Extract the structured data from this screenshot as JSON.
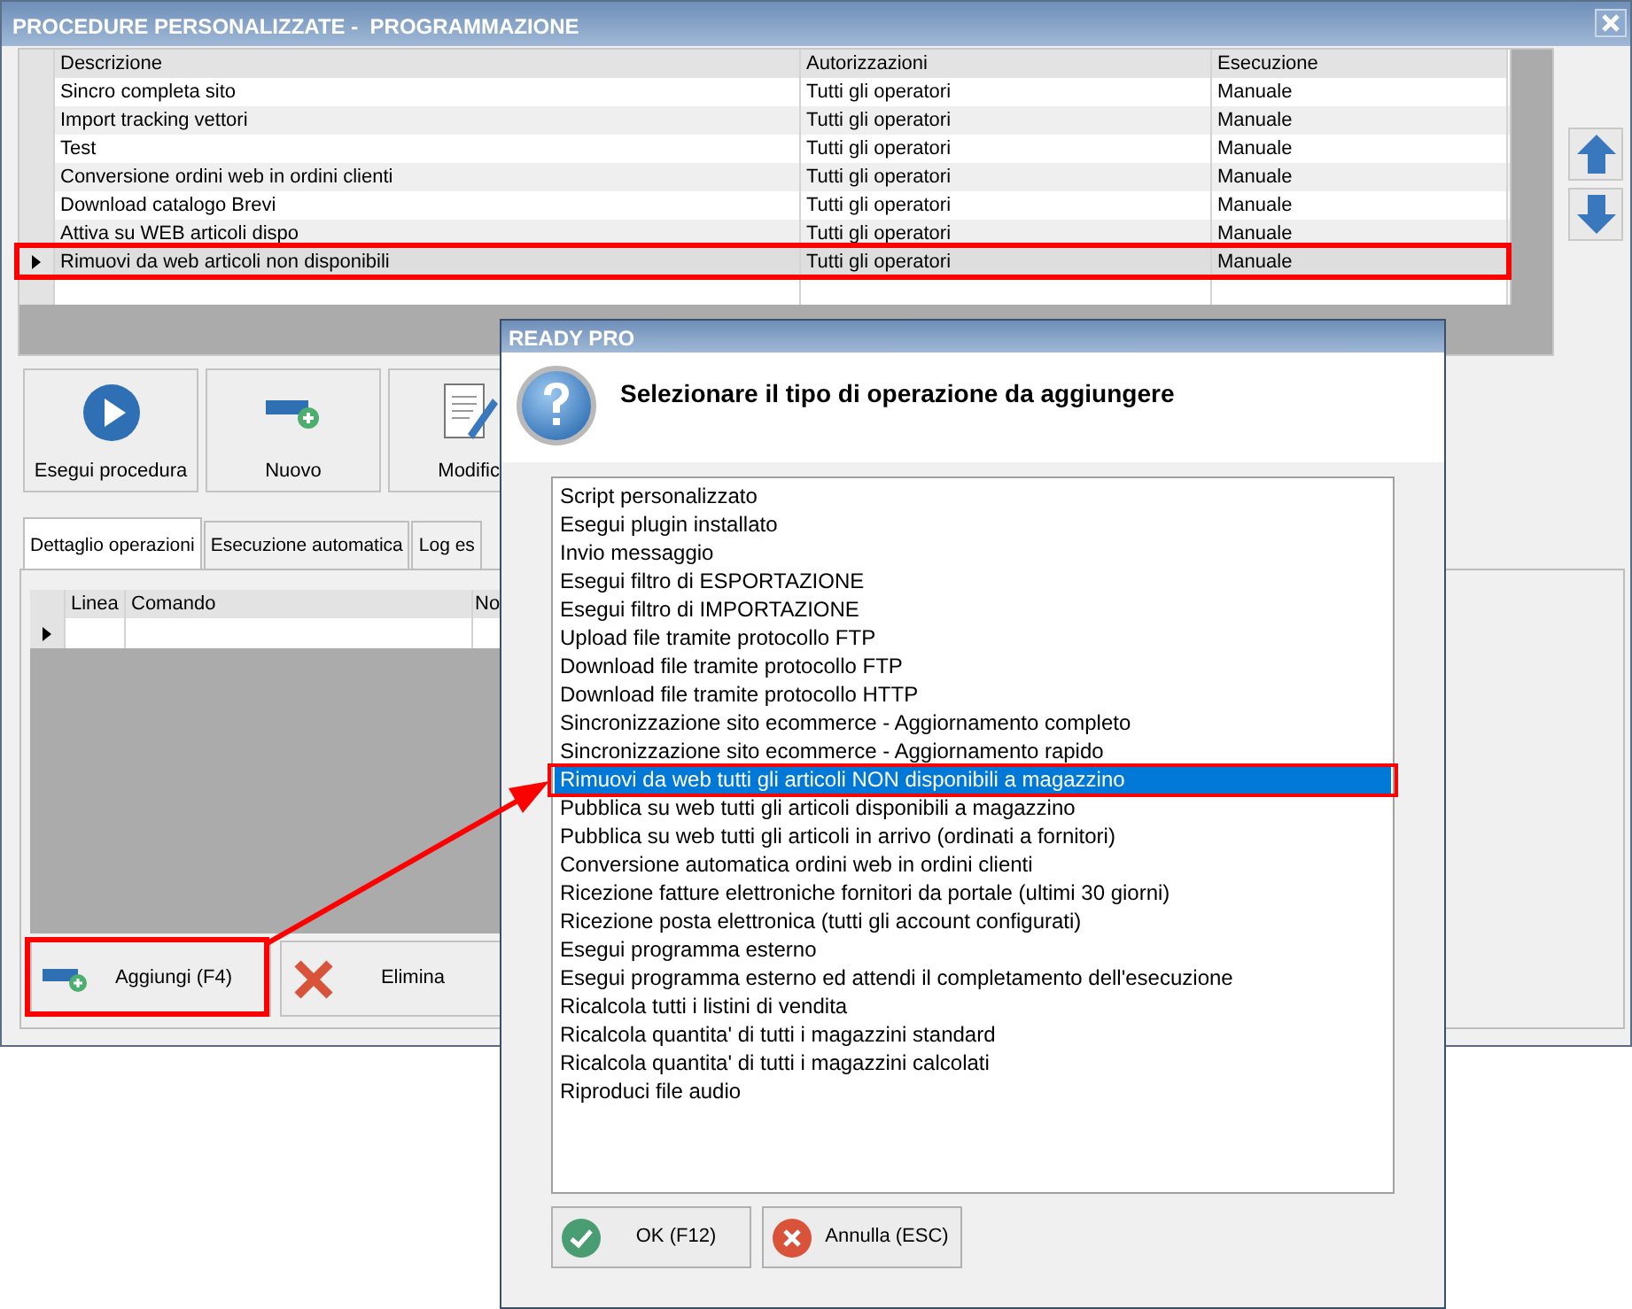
{
  "window": {
    "title": "PROCEDURE PERSONALIZZATE -  PROGRAMMAZIONE"
  },
  "procedures": {
    "columns": [
      "Descrizione",
      "Autorizzazioni",
      "Esecuzione"
    ],
    "rows": [
      {
        "cells": [
          "Sincro completa sito",
          "Tutti gli operatori",
          "Manuale"
        ],
        "selected": false
      },
      {
        "cells": [
          "Import tracking vettori",
          "Tutti gli operatori",
          "Manuale"
        ],
        "selected": false
      },
      {
        "cells": [
          "Test",
          "Tutti gli operatori",
          "Manuale"
        ],
        "selected": false
      },
      {
        "cells": [
          "Conversione ordini web in ordini clienti",
          "Tutti gli operatori",
          "Manuale"
        ],
        "selected": false
      },
      {
        "cells": [
          "Download catalogo Brevi",
          "Tutti gli operatori",
          "Manuale"
        ],
        "selected": false
      },
      {
        "cells": [
          "Attiva su WEB articoli dispo",
          "Tutti gli operatori",
          "Manuale"
        ],
        "selected": false
      },
      {
        "cells": [
          "Rimuovi da web articoli non disponibili",
          "Tutti gli operatori",
          "Manuale"
        ],
        "selected": true
      }
    ]
  },
  "toolbar": [
    {
      "label": "Esegui procedura",
      "kind": "run"
    },
    {
      "label": "Nuovo",
      "kind": "new"
    },
    {
      "label": "Modific",
      "kind": "edit"
    }
  ],
  "tabs": [
    {
      "label": "Dettaglio operazioni",
      "selected": true
    },
    {
      "label": "Esecuzione automatica",
      "selected": false
    },
    {
      "label": "Log es",
      "selected": false
    }
  ],
  "operations": {
    "columns": [
      "Linea",
      "Comando",
      "No"
    ],
    "rows": [
      {
        "current": true
      }
    ]
  },
  "operation_buttons": [
    {
      "label": "Aggiungi (F4)",
      "kind": "add"
    },
    {
      "label": "Elimina",
      "kind": "delete"
    }
  ],
  "dialog": {
    "title": "READY PRO",
    "heading": "Selezionare il tipo di operazione da aggiungere",
    "options": [
      {
        "label": "Script personalizzato",
        "selected": false
      },
      {
        "label": "Esegui plugin installato",
        "selected": false
      },
      {
        "label": "Invio messaggio",
        "selected": false
      },
      {
        "label": "Esegui filtro di ESPORTAZIONE",
        "selected": false
      },
      {
        "label": "Esegui filtro di IMPORTAZIONE",
        "selected": false
      },
      {
        "label": "Upload file tramite protocollo FTP",
        "selected": false
      },
      {
        "label": "Download file tramite protocollo FTP",
        "selected": false
      },
      {
        "label": "Download file tramite protocollo HTTP",
        "selected": false
      },
      {
        "label": "Sincronizzazione sito ecommerce - Aggiornamento completo",
        "selected": false
      },
      {
        "label": "Sincronizzazione sito ecommerce - Aggiornamento rapido",
        "selected": false
      },
      {
        "label": "Rimuovi da web tutti gli articoli NON disponibili a magazzino",
        "selected": true
      },
      {
        "label": "Pubblica su web tutti gli articoli disponibili a magazzino",
        "selected": false
      },
      {
        "label": "Pubblica su web tutti gli articoli in arrivo (ordinati a fornitori)",
        "selected": false
      },
      {
        "label": "Conversione automatica ordini web in ordini clienti",
        "selected": false
      },
      {
        "label": "Ricezione fatture elettroniche fornitori da portale (ultimi 30 giorni)",
        "selected": false
      },
      {
        "label": "Ricezione posta elettronica (tutti gli account configurati)",
        "selected": false
      },
      {
        "label": "Esegui programma esterno",
        "selected": false
      },
      {
        "label": "Esegui programma esterno ed attendi il completamento dell'esecuzione",
        "selected": false
      },
      {
        "label": "Ricalcola tutti i listini di vendita",
        "selected": false
      },
      {
        "label": "Ricalcola quantita' di tutti i magazzini standard",
        "selected": false
      },
      {
        "label": "Ricalcola quantita' di tutti i magazzini calcolati",
        "selected": false
      },
      {
        "label": "Riproduci file audio",
        "selected": false
      }
    ],
    "buttons": [
      {
        "label": "OK (F12)",
        "kind": "ok"
      },
      {
        "label": "Annulla (ESC)",
        "kind": "cancel"
      }
    ]
  }
}
